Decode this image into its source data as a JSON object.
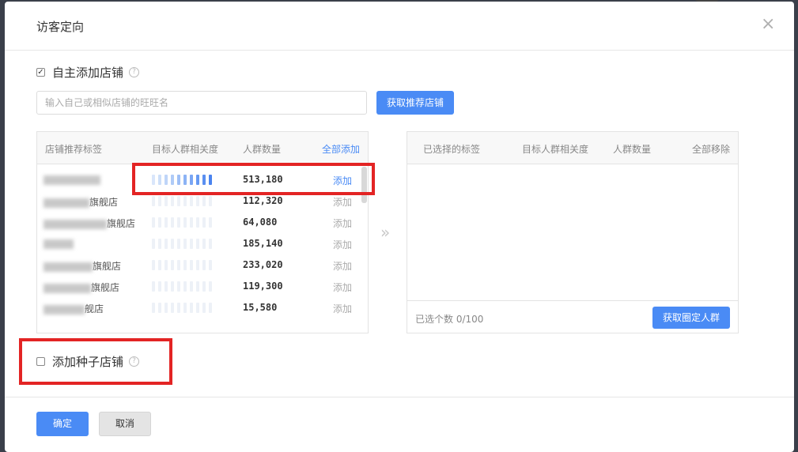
{
  "dialog": {
    "title": "访客定向",
    "close_glyph": "×"
  },
  "self_add": {
    "checked": true,
    "label": "自主添加店铺",
    "help_glyph": "?",
    "search_placeholder": "输入自己或相似店铺的旺旺名",
    "fetch_button": "获取推荐店铺"
  },
  "left_table": {
    "columns": [
      "店铺推荐标签",
      "目标人群相关度",
      "人群数量"
    ],
    "add_all": "全部添加",
    "rows": [
      {
        "suffix": "",
        "relevance_level": 1.0,
        "count": "513,180",
        "action": "添加"
      },
      {
        "suffix": "旗舰店",
        "relevance_level": 0,
        "count": "112,320",
        "action": "添加"
      },
      {
        "suffix": "旗舰店",
        "relevance_level": 0,
        "count": "64,080",
        "action": "添加"
      },
      {
        "suffix": "",
        "relevance_level": 0,
        "count": "185,140",
        "action": "添加"
      },
      {
        "suffix": "旗舰店",
        "relevance_level": 0,
        "count": "233,020",
        "action": "添加"
      },
      {
        "suffix": "旗舰店",
        "relevance_level": 0,
        "count": "119,300",
        "action": "添加"
      },
      {
        "suffix": "舰店",
        "relevance_level": 0,
        "count": "15,580",
        "action": "添加"
      }
    ]
  },
  "transfer_arrow": "»",
  "right_table": {
    "columns": [
      "已选择的标签",
      "目标人群相关度",
      "人群数量"
    ],
    "remove_all": "全部移除",
    "selected_count": "已选个数 0/100",
    "fetch_button": "获取圈定人群"
  },
  "seed_store": {
    "checked": false,
    "label": "添加种子店铺",
    "help_glyph": "?"
  },
  "footer": {
    "confirm": "确定",
    "cancel": "取消"
  },
  "colors": {
    "primary": "#4a8bf5",
    "highlight_box": "#e32424"
  }
}
